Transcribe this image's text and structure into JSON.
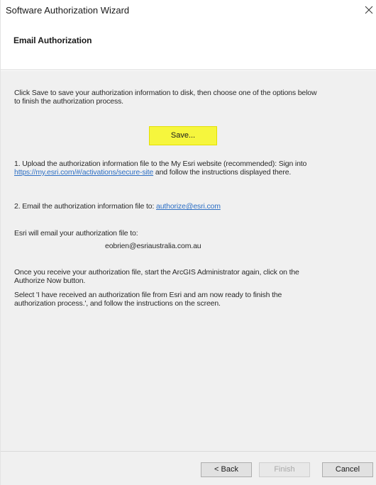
{
  "window": {
    "title": "Software Authorization Wizard",
    "close_icon": "close-icon"
  },
  "header": {
    "title": "Email Authorization"
  },
  "content": {
    "intro_line1": "Click Save to save your authorization information to disk, then choose one of the options below",
    "intro_line2": "to finish the authorization process.",
    "save_label": "Save...",
    "step1_line1": "1.  Upload the authorization information file to the My Esri website (recommended): Sign into",
    "step1_link": "https://my.esri.com/#/activations/secure-site",
    "step1_line2_rest": " and follow the instructions displayed there.",
    "step2_text": "2.  Email the authorization information file to: ",
    "step2_link": "authorize@esri.com",
    "email_intro": "Esri will email your authorization file to:",
    "email_address": "eobrien@esriaustralia.com.au",
    "receive_line1": "Once you receive your authorization file, start the ArcGIS Administrator again, click on the",
    "receive_line2": "Authorize Now button.",
    "select_line1": "Select 'I have received an authorization file from Esri and am now ready to finish the",
    "select_line2": "authorization process.', and follow the instructions on the screen."
  },
  "footer": {
    "back_label": "< Back",
    "finish_label": "Finish",
    "cancel_label": "Cancel"
  },
  "colors": {
    "highlight": "#f6f63d",
    "link": "#2d6fc4",
    "content_bg": "#f0f0f0"
  }
}
